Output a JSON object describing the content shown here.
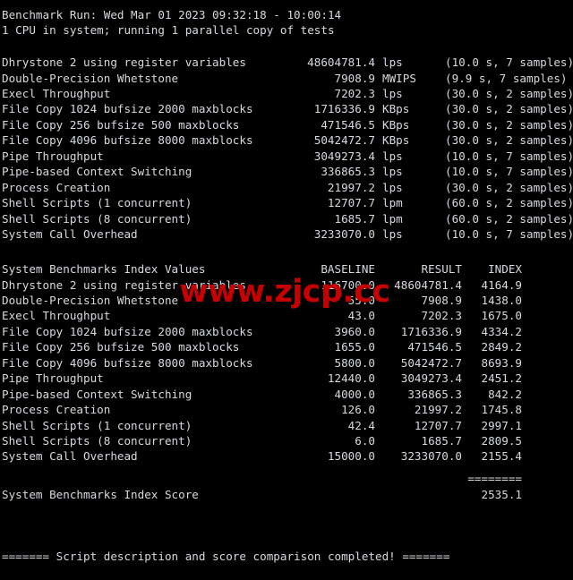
{
  "terminal": {
    "background_color": "#000000",
    "text_color": "#d6dae0",
    "header": {
      "run_line": "Benchmark Run: Wed Mar 01 2023 09:32:18 - 10:00:14",
      "cpu_line": "1 CPU in system; running 1 parallel copy of tests"
    },
    "results": {
      "rows": [
        {
          "label": "Dhrystone 2 using register variables",
          "value": "48604781.4",
          "unit": "lps",
          "detail": "(10.0 s, 7 samples)"
        },
        {
          "label": "Double-Precision Whetstone",
          "value": "7908.9",
          "unit": "MWIPS",
          "detail": "(9.9 s, 7 samples)"
        },
        {
          "label": "Execl Throughput",
          "value": "7202.3",
          "unit": "lps",
          "detail": "(30.0 s, 2 samples)"
        },
        {
          "label": "File Copy 1024 bufsize 2000 maxblocks",
          "value": "1716336.9",
          "unit": "KBps",
          "detail": "(30.0 s, 2 samples)"
        },
        {
          "label": "File Copy 256 bufsize 500 maxblocks",
          "value": "471546.5",
          "unit": "KBps",
          "detail": "(30.0 s, 2 samples)"
        },
        {
          "label": "File Copy 4096 bufsize 8000 maxblocks",
          "value": "5042472.7",
          "unit": "KBps",
          "detail": "(30.0 s, 2 samples)"
        },
        {
          "label": "Pipe Throughput",
          "value": "3049273.4",
          "unit": "lps",
          "detail": "(10.0 s, 7 samples)"
        },
        {
          "label": "Pipe-based Context Switching",
          "value": "336865.3",
          "unit": "lps",
          "detail": "(10.0 s, 7 samples)"
        },
        {
          "label": "Process Creation",
          "value": "21997.2",
          "unit": "lps",
          "detail": "(30.0 s, 2 samples)"
        },
        {
          "label": "Shell Scripts (1 concurrent)",
          "value": "12707.7",
          "unit": "lpm",
          "detail": "(60.0 s, 2 samples)"
        },
        {
          "label": "Shell Scripts (8 concurrent)",
          "value": "1685.7",
          "unit": "lpm",
          "detail": "(60.0 s, 2 samples)"
        },
        {
          "label": "System Call Overhead",
          "value": "3233070.0",
          "unit": "lps",
          "detail": "(10.0 s, 7 samples)"
        }
      ]
    },
    "index_table": {
      "title": "System Benchmarks Index Values",
      "columns": [
        "BASELINE",
        "RESULT",
        "INDEX"
      ],
      "rows": [
        {
          "label": "Dhrystone 2 using register variables",
          "baseline": "116700.0",
          "result": "48604781.4",
          "index": "4164.9"
        },
        {
          "label": "Double-Precision Whetstone",
          "baseline": "55.0",
          "result": "7908.9",
          "index": "1438.0"
        },
        {
          "label": "Execl Throughput",
          "baseline": "43.0",
          "result": "7202.3",
          "index": "1675.0"
        },
        {
          "label": "File Copy 1024 bufsize 2000 maxblocks",
          "baseline": "3960.0",
          "result": "1716336.9",
          "index": "4334.2"
        },
        {
          "label": "File Copy 256 bufsize 500 maxblocks",
          "baseline": "1655.0",
          "result": "471546.5",
          "index": "2849.2"
        },
        {
          "label": "File Copy 4096 bufsize 8000 maxblocks",
          "baseline": "5800.0",
          "result": "5042472.7",
          "index": "8693.9"
        },
        {
          "label": "Pipe Throughput",
          "baseline": "12440.0",
          "result": "3049273.4",
          "index": "2451.2"
        },
        {
          "label": "Pipe-based Context Switching",
          "baseline": "4000.0",
          "result": "336865.3",
          "index": "842.2"
        },
        {
          "label": "Process Creation",
          "baseline": "126.0",
          "result": "21997.2",
          "index": "1745.8"
        },
        {
          "label": "Shell Scripts (1 concurrent)",
          "baseline": "42.4",
          "result": "12707.7",
          "index": "2997.1"
        },
        {
          "label": "Shell Scripts (8 concurrent)",
          "baseline": "6.0",
          "result": "1685.7",
          "index": "2809.5"
        },
        {
          "label": "System Call Overhead",
          "baseline": "15000.0",
          "result": "3233070.0",
          "index": "2155.4"
        }
      ],
      "separator": "========",
      "score_label": "System Benchmarks Index Score",
      "score_value": "2535.1"
    },
    "footer": {
      "completion_line": "======= Script description and score comparison completed! ======="
    }
  },
  "watermark": {
    "text": "www.zjcp.cc",
    "color": "#c60000"
  }
}
